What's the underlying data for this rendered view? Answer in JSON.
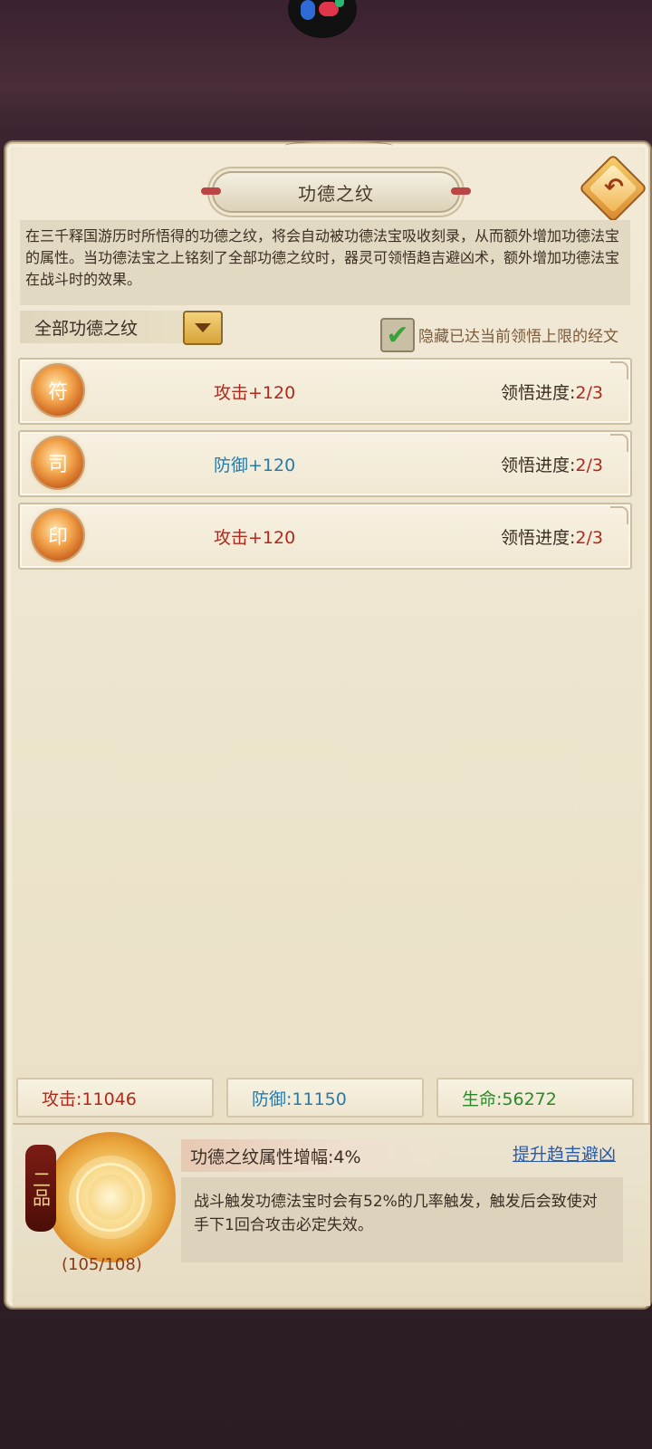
{
  "title": "功德之纹",
  "description": "在三千释国游历时所悟得的功德之纹，将会自动被功德法宝吸收刻录，从而额外增加功德法宝的属性。当功德法宝之上铭刻了全部功德之纹时，器灵可领悟趋吉避凶术，额外增加功德法宝在战斗时的效果。",
  "filter": {
    "selected": "全部功德之纹"
  },
  "hide_option": {
    "label": "隐藏已达当前领悟上限的经文",
    "checked": true
  },
  "items": [
    {
      "stat": "攻击+120",
      "progress_label": "领悟进度:",
      "progress_value": "2/3",
      "color": "#b02a1c"
    },
    {
      "stat": "防御+120",
      "progress_label": "领悟进度:",
      "progress_value": "2/3",
      "color": "#2a7aa8"
    },
    {
      "stat": "攻击+120",
      "progress_label": "领悟进度:",
      "progress_value": "2/3",
      "color": "#b02a1c"
    }
  ],
  "totals": {
    "attack": "攻击:11046",
    "defense": "防御:11150",
    "life": "生命:56272"
  },
  "bottom": {
    "grade": "二品",
    "count": "(105/108)",
    "bonus_title": "功德之纹属性增幅:4%",
    "upgrade_link": "提升趋吉避凶",
    "effect_text": "战斗触发功德法宝时会有52%的几率触发，触发后会致使对手下1回合攻击必定失效。"
  },
  "icons": [
    "back-arrow-icon",
    "dropdown-arrow-icon",
    "checkmark-icon",
    "rune-emblem-icon",
    "merit-seal-icon"
  ]
}
